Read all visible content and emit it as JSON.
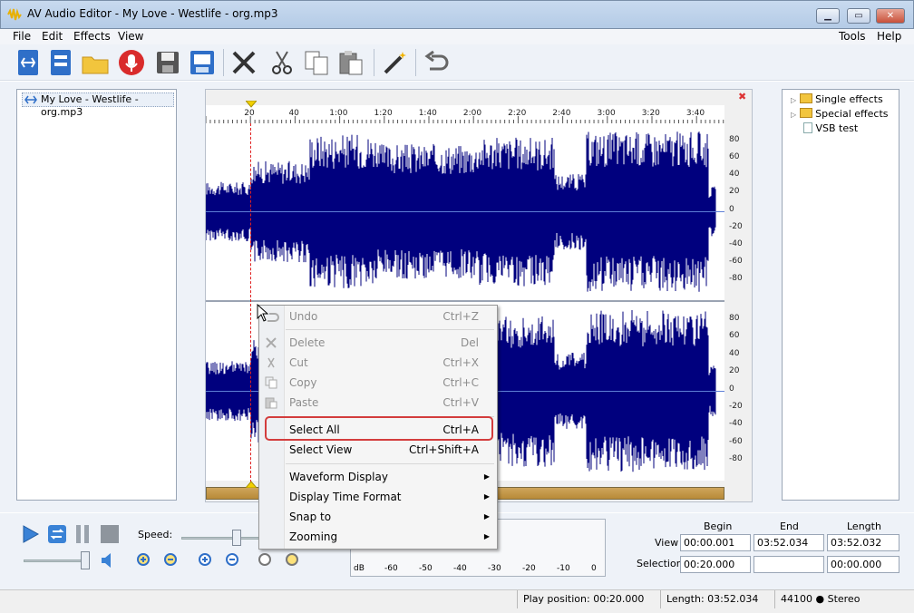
{
  "app": {
    "title": "AV Audio Editor - My Love - Westlife - org.mp3"
  },
  "menu": {
    "file": "File",
    "edit": "Edit",
    "effects": "Effects",
    "view": "View",
    "tools": "Tools",
    "help": "Help"
  },
  "toolbar_icons": [
    "new-icon",
    "open-list-icon",
    "folder-icon",
    "record-icon",
    "save-icon",
    "save-as-icon",
    "delete-icon",
    "cut-icon",
    "copy-icon",
    "paste-icon",
    "magic-wand-icon",
    "undo-icon"
  ],
  "files": {
    "item": "My Love - Westlife - org.mp3"
  },
  "ruler": {
    "labels": [
      "20",
      "40",
      "1:00",
      "1:20",
      "1:40",
      "2:00",
      "2:20",
      "2:40",
      "3:00",
      "3:20",
      "3:40"
    ]
  },
  "db_labels": [
    "80",
    "60",
    "40",
    "20",
    "0",
    "-20",
    "-40",
    "-60",
    "-80"
  ],
  "effects": {
    "items": [
      "Single effects",
      "Special effects",
      "VSB test"
    ]
  },
  "context_menu": {
    "undo": {
      "label": "Undo",
      "shortcut": "Ctrl+Z"
    },
    "delete": {
      "label": "Delete",
      "shortcut": "Del"
    },
    "cut": {
      "label": "Cut",
      "shortcut": "Ctrl+X"
    },
    "copy": {
      "label": "Copy",
      "shortcut": "Ctrl+C"
    },
    "paste": {
      "label": "Paste",
      "shortcut": "Ctrl+V"
    },
    "select_all": {
      "label": "Select All",
      "shortcut": "Ctrl+A"
    },
    "select_view": {
      "label": "Select View",
      "shortcut": "Ctrl+Shift+A"
    },
    "waveform_display": {
      "label": "Waveform Display"
    },
    "display_time_format": {
      "label": "Display Time Format"
    },
    "snap_to": {
      "label": "Snap to"
    },
    "zooming": {
      "label": "Zooming"
    }
  },
  "transport": {
    "speed_label": "Speed:"
  },
  "meter": {
    "labels": [
      "dB",
      "-60",
      "-50",
      "-40",
      "-30",
      "-20",
      "-10",
      "0"
    ]
  },
  "time": {
    "headers": {
      "begin": "Begin",
      "end": "End",
      "length": "Length"
    },
    "view_label": "View",
    "selection_label": "Selection",
    "view_begin": "00:00.001",
    "view_end": "03:52.034",
    "view_length": "03:52.032",
    "sel_begin": "00:20.000",
    "sel_end": "",
    "sel_length": "00:00.000"
  },
  "status": {
    "play_position": "Play position: 00:20.000",
    "length": "Length: 03:52.034",
    "format": "44100 ● Stereo"
  },
  "colors": {
    "waveform": "#00007e",
    "highlight": "#d33d3d",
    "accent": "#2d6cc5"
  }
}
